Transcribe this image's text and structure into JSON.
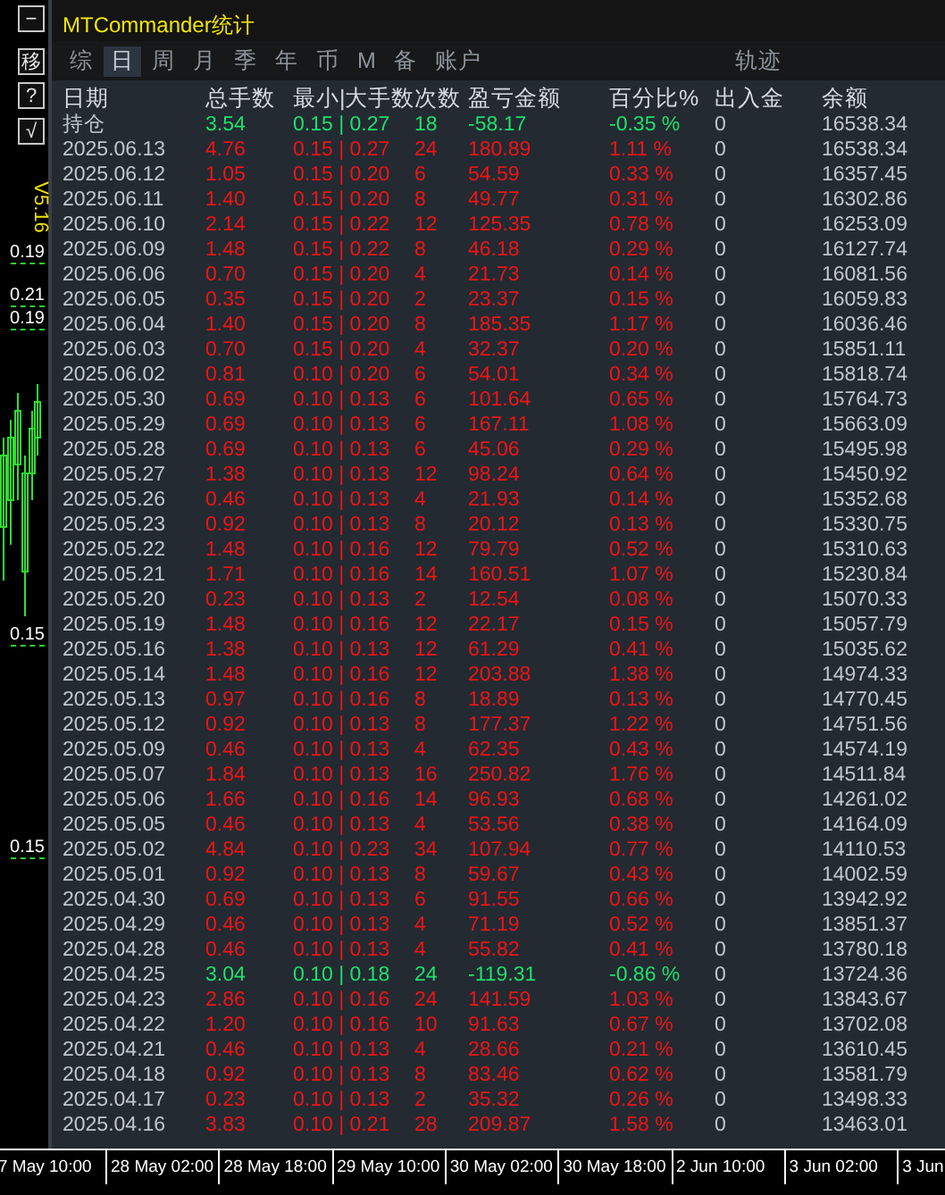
{
  "side_tools": [
    "−",
    "移",
    "?",
    "√"
  ],
  "chart_labels": [
    {
      "text": "V5.16",
      "kind": "version"
    },
    {
      "text": "0.19",
      "kind": "price"
    },
    {
      "text": "0.21",
      "kind": "price"
    },
    {
      "text": "0.19",
      "kind": "price"
    },
    {
      "text": "0.15",
      "kind": "price"
    },
    {
      "text": "0.15",
      "kind": "price"
    }
  ],
  "window": {
    "title": "MTCommander统计"
  },
  "tabs": [
    {
      "label": "综",
      "selected": false
    },
    {
      "label": "日",
      "selected": true
    },
    {
      "label": "周",
      "selected": false
    },
    {
      "label": "月",
      "selected": false
    },
    {
      "label": "季",
      "selected": false
    },
    {
      "label": "年",
      "selected": false
    },
    {
      "label": "币",
      "selected": false
    },
    {
      "label": "M",
      "selected": false
    },
    {
      "label": "备",
      "selected": false
    },
    {
      "label": "账户",
      "selected": false
    },
    {
      "label": "轨迹",
      "selected": false
    }
  ],
  "table": {
    "columns": [
      "日期",
      "总手数",
      "最小|大手数",
      "次数",
      "盈亏金额",
      "百分比%",
      "出入金",
      "余额"
    ],
    "rows": [
      {
        "cells": [
          "持仓",
          "3.54",
          "0.15 | 0.27",
          "18",
          "-58.17",
          "-0.35 %",
          "0",
          "16538.34"
        ],
        "loss": true
      },
      {
        "cells": [
          "2025.06.13",
          "4.76",
          "0.15 | 0.27",
          "24",
          "180.89",
          "1.11 %",
          "0",
          "16538.34"
        ],
        "loss": false
      },
      {
        "cells": [
          "2025.06.12",
          "1.05",
          "0.15 | 0.20",
          "6",
          "54.59",
          "0.33 %",
          "0",
          "16357.45"
        ],
        "loss": false
      },
      {
        "cells": [
          "2025.06.11",
          "1.40",
          "0.15 | 0.20",
          "8",
          "49.77",
          "0.31 %",
          "0",
          "16302.86"
        ],
        "loss": false
      },
      {
        "cells": [
          "2025.06.10",
          "2.14",
          "0.15 | 0.22",
          "12",
          "125.35",
          "0.78 %",
          "0",
          "16253.09"
        ],
        "loss": false
      },
      {
        "cells": [
          "2025.06.09",
          "1.48",
          "0.15 | 0.22",
          "8",
          "46.18",
          "0.29 %",
          "0",
          "16127.74"
        ],
        "loss": false
      },
      {
        "cells": [
          "2025.06.06",
          "0.70",
          "0.15 | 0.20",
          "4",
          "21.73",
          "0.14 %",
          "0",
          "16081.56"
        ],
        "loss": false
      },
      {
        "cells": [
          "2025.06.05",
          "0.35",
          "0.15 | 0.20",
          "2",
          "23.37",
          "0.15 %",
          "0",
          "16059.83"
        ],
        "loss": false
      },
      {
        "cells": [
          "2025.06.04",
          "1.40",
          "0.15 | 0.20",
          "8",
          "185.35",
          "1.17 %",
          "0",
          "16036.46"
        ],
        "loss": false
      },
      {
        "cells": [
          "2025.06.03",
          "0.70",
          "0.15 | 0.20",
          "4",
          "32.37",
          "0.20 %",
          "0",
          "15851.11"
        ],
        "loss": false
      },
      {
        "cells": [
          "2025.06.02",
          "0.81",
          "0.10 | 0.20",
          "6",
          "54.01",
          "0.34 %",
          "0",
          "15818.74"
        ],
        "loss": false
      },
      {
        "cells": [
          "2025.05.30",
          "0.69",
          "0.10 | 0.13",
          "6",
          "101.64",
          "0.65 %",
          "0",
          "15764.73"
        ],
        "loss": false
      },
      {
        "cells": [
          "2025.05.29",
          "0.69",
          "0.10 | 0.13",
          "6",
          "167.11",
          "1.08 %",
          "0",
          "15663.09"
        ],
        "loss": false
      },
      {
        "cells": [
          "2025.05.28",
          "0.69",
          "0.10 | 0.13",
          "6",
          "45.06",
          "0.29 %",
          "0",
          "15495.98"
        ],
        "loss": false
      },
      {
        "cells": [
          "2025.05.27",
          "1.38",
          "0.10 | 0.13",
          "12",
          "98.24",
          "0.64 %",
          "0",
          "15450.92"
        ],
        "loss": false
      },
      {
        "cells": [
          "2025.05.26",
          "0.46",
          "0.10 | 0.13",
          "4",
          "21.93",
          "0.14 %",
          "0",
          "15352.68"
        ],
        "loss": false
      },
      {
        "cells": [
          "2025.05.23",
          "0.92",
          "0.10 | 0.13",
          "8",
          "20.12",
          "0.13 %",
          "0",
          "15330.75"
        ],
        "loss": false
      },
      {
        "cells": [
          "2025.05.22",
          "1.48",
          "0.10 | 0.16",
          "12",
          "79.79",
          "0.52 %",
          "0",
          "15310.63"
        ],
        "loss": false
      },
      {
        "cells": [
          "2025.05.21",
          "1.71",
          "0.10 | 0.16",
          "14",
          "160.51",
          "1.07 %",
          "0",
          "15230.84"
        ],
        "loss": false
      },
      {
        "cells": [
          "2025.05.20",
          "0.23",
          "0.10 | 0.13",
          "2",
          "12.54",
          "0.08 %",
          "0",
          "15070.33"
        ],
        "loss": false
      },
      {
        "cells": [
          "2025.05.19",
          "1.48",
          "0.10 | 0.16",
          "12",
          "22.17",
          "0.15 %",
          "0",
          "15057.79"
        ],
        "loss": false
      },
      {
        "cells": [
          "2025.05.16",
          "1.38",
          "0.10 | 0.13",
          "12",
          "61.29",
          "0.41 %",
          "0",
          "15035.62"
        ],
        "loss": false
      },
      {
        "cells": [
          "2025.05.14",
          "1.48",
          "0.10 | 0.16",
          "12",
          "203.88",
          "1.38 %",
          "0",
          "14974.33"
        ],
        "loss": false
      },
      {
        "cells": [
          "2025.05.13",
          "0.97",
          "0.10 | 0.16",
          "8",
          "18.89",
          "0.13 %",
          "0",
          "14770.45"
        ],
        "loss": false
      },
      {
        "cells": [
          "2025.05.12",
          "0.92",
          "0.10 | 0.13",
          "8",
          "177.37",
          "1.22 %",
          "0",
          "14751.56"
        ],
        "loss": false
      },
      {
        "cells": [
          "2025.05.09",
          "0.46",
          "0.10 | 0.13",
          "4",
          "62.35",
          "0.43 %",
          "0",
          "14574.19"
        ],
        "loss": false
      },
      {
        "cells": [
          "2025.05.07",
          "1.84",
          "0.10 | 0.13",
          "16",
          "250.82",
          "1.76 %",
          "0",
          "14511.84"
        ],
        "loss": false
      },
      {
        "cells": [
          "2025.05.06",
          "1.66",
          "0.10 | 0.16",
          "14",
          "96.93",
          "0.68 %",
          "0",
          "14261.02"
        ],
        "loss": false
      },
      {
        "cells": [
          "2025.05.05",
          "0.46",
          "0.10 | 0.13",
          "4",
          "53.56",
          "0.38 %",
          "0",
          "14164.09"
        ],
        "loss": false
      },
      {
        "cells": [
          "2025.05.02",
          "4.84",
          "0.10 | 0.23",
          "34",
          "107.94",
          "0.77 %",
          "0",
          "14110.53"
        ],
        "loss": false
      },
      {
        "cells": [
          "2025.05.01",
          "0.92",
          "0.10 | 0.13",
          "8",
          "59.67",
          "0.43 %",
          "0",
          "14002.59"
        ],
        "loss": false
      },
      {
        "cells": [
          "2025.04.30",
          "0.69",
          "0.10 | 0.13",
          "6",
          "91.55",
          "0.66 %",
          "0",
          "13942.92"
        ],
        "loss": false
      },
      {
        "cells": [
          "2025.04.29",
          "0.46",
          "0.10 | 0.13",
          "4",
          "71.19",
          "0.52 %",
          "0",
          "13851.37"
        ],
        "loss": false
      },
      {
        "cells": [
          "2025.04.28",
          "0.46",
          "0.10 | 0.13",
          "4",
          "55.82",
          "0.41 %",
          "0",
          "13780.18"
        ],
        "loss": false
      },
      {
        "cells": [
          "2025.04.25",
          "3.04",
          "0.10 | 0.18",
          "24",
          "-119.31",
          "-0.86 %",
          "0",
          "13724.36"
        ],
        "loss": true
      },
      {
        "cells": [
          "2025.04.23",
          "2.86",
          "0.10 | 0.16",
          "24",
          "141.59",
          "1.03 %",
          "0",
          "13843.67"
        ],
        "loss": false
      },
      {
        "cells": [
          "2025.04.22",
          "1.20",
          "0.10 | 0.16",
          "10",
          "91.63",
          "0.67 %",
          "0",
          "13702.08"
        ],
        "loss": false
      },
      {
        "cells": [
          "2025.04.21",
          "0.46",
          "0.10 | 0.13",
          "4",
          "28.66",
          "0.21 %",
          "0",
          "13610.45"
        ],
        "loss": false
      },
      {
        "cells": [
          "2025.04.18",
          "0.92",
          "0.10 | 0.13",
          "8",
          "83.46",
          "0.62 %",
          "0",
          "13581.79"
        ],
        "loss": false
      },
      {
        "cells": [
          "2025.04.17",
          "0.23",
          "0.10 | 0.13",
          "2",
          "35.32",
          "0.26 %",
          "0",
          "13498.33"
        ],
        "loss": false
      },
      {
        "cells": [
          "2025.04.16",
          "3.83",
          "0.10 | 0.21",
          "28",
          "209.87",
          "1.58 %",
          "0",
          "13463.01"
        ],
        "loss": false
      }
    ]
  },
  "time_axis": [
    "7 May 10:00",
    "28 May 02:00",
    "28 May 18:00",
    "29 May 10:00",
    "30 May 02:00",
    "30 May 18:00",
    "2 Jun 10:00",
    "3 Jun 02:00",
    "3 Jun"
  ]
}
